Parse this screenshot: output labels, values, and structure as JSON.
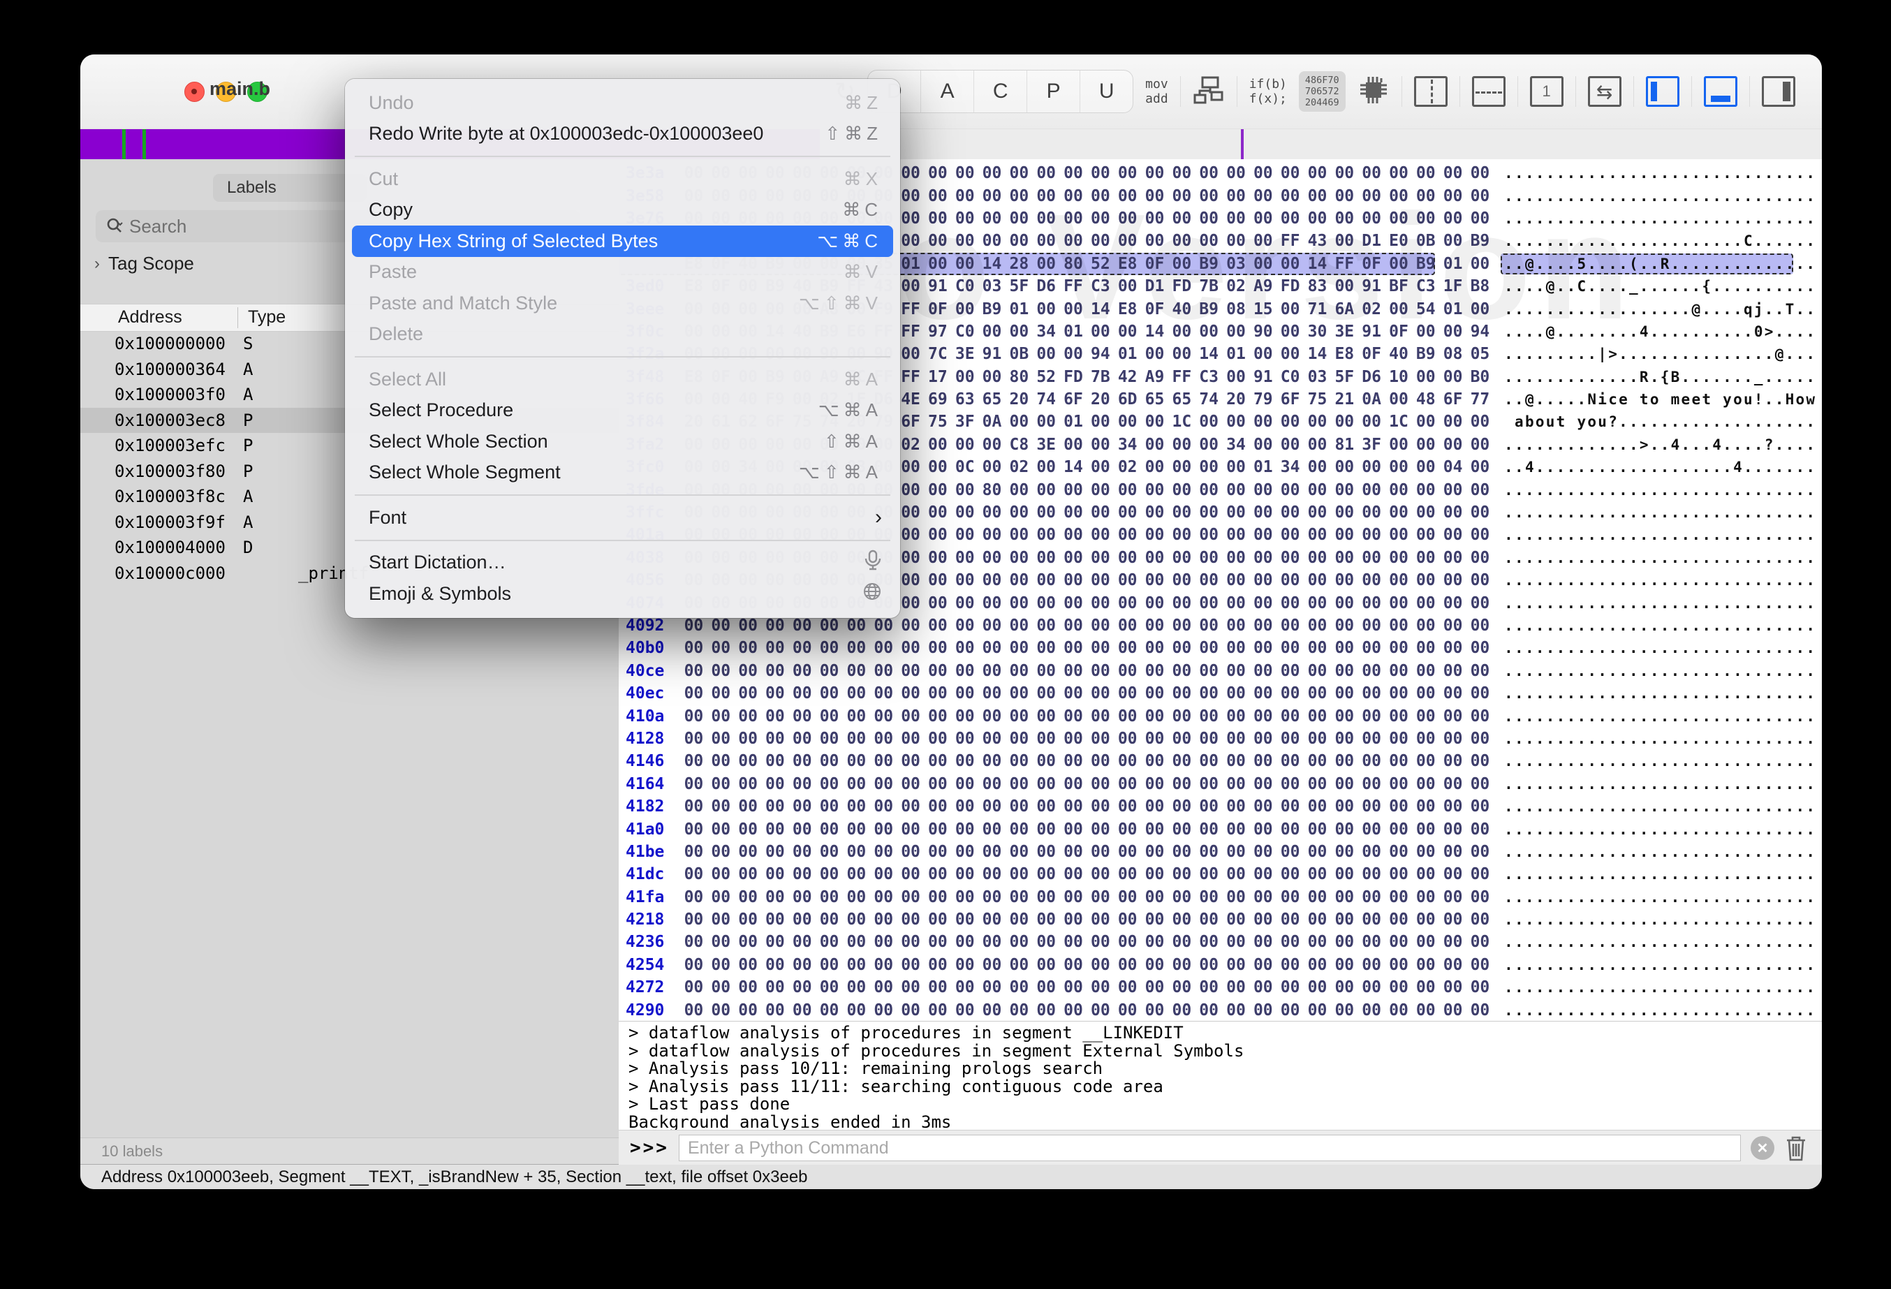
{
  "window": {
    "title": "main.b"
  },
  "menu": {
    "items": [
      {
        "label": "Undo",
        "shortcut": "⌘Z",
        "state": "disabled"
      },
      {
        "label": "Redo Write byte at 0x100003edc-0x100003ee0",
        "shortcut": "⇧⌘Z",
        "state": "enabled"
      },
      {
        "type": "sep"
      },
      {
        "label": "Cut",
        "shortcut": "⌘X",
        "state": "disabled"
      },
      {
        "label": "Copy",
        "shortcut": "⌘C",
        "state": "enabled"
      },
      {
        "label": "Copy Hex String of Selected Bytes",
        "shortcut": "⌥⌘C",
        "state": "highlighted"
      },
      {
        "label": "Paste",
        "shortcut": "⌘V",
        "state": "disabled"
      },
      {
        "label": "Paste and Match Style",
        "shortcut": "⌥⇧⌘V",
        "state": "disabled"
      },
      {
        "label": "Delete",
        "shortcut": "",
        "state": "disabled"
      },
      {
        "type": "sep"
      },
      {
        "label": "Select All",
        "shortcut": "⌘A",
        "state": "disabled"
      },
      {
        "label": "Select Procedure",
        "shortcut": "⌥⌘A",
        "state": "enabled"
      },
      {
        "label": "Select Whole Section",
        "shortcut": "⇧⌘A",
        "state": "enabled"
      },
      {
        "label": "Select Whole Segment",
        "shortcut": "⌥⇧⌘A",
        "state": "enabled"
      },
      {
        "type": "sep"
      },
      {
        "label": "Font",
        "state": "enabled",
        "submenu": true
      },
      {
        "type": "sep"
      },
      {
        "label": "Start Dictation…",
        "state": "enabled",
        "icon": "microphone"
      },
      {
        "label": "Emoji & Symbols",
        "state": "enabled",
        "icon": "globe"
      }
    ]
  },
  "toolbar": {
    "refresh": "↻",
    "modes": [
      "D",
      "A",
      "C",
      "P",
      "U"
    ],
    "mov_add": [
      "mov",
      "add"
    ],
    "if_fx": [
      "if(b)",
      "f(x);"
    ],
    "hex_chip": [
      "486F70",
      "706572",
      "204469"
    ],
    "swap_glyph": "⇆",
    "one_label": "1"
  },
  "sidebar": {
    "tab": "Labels",
    "search_placeholder": "Search",
    "tag_scope": "Tag Scope",
    "columns": {
      "address": "Address",
      "type": "Type"
    },
    "rows": [
      {
        "address": "0x100000000",
        "type": "S",
        "name": ""
      },
      {
        "address": "0x100000364",
        "type": "A",
        "name": ""
      },
      {
        "address": "0x1000003f0",
        "type": "A",
        "name": ""
      },
      {
        "address": "0x100003ec8",
        "type": "P",
        "name": "",
        "selected": true
      },
      {
        "address": "0x100003efc",
        "type": "P",
        "name": ""
      },
      {
        "address": "0x100003f80",
        "type": "P",
        "name": ""
      },
      {
        "address": "0x100003f8c",
        "type": "A",
        "name": ""
      },
      {
        "address": "0x100003f9f",
        "type": "A",
        "name": ""
      },
      {
        "address": "0x100004000",
        "type": "D",
        "name": ""
      },
      {
        "address": "0x10000c000",
        "type": "",
        "name": "_printf"
      }
    ],
    "footer": "10 labels"
  },
  "hex": {
    "watermark": "Demo Version",
    "colors": {
      "address": "#1414cc",
      "bytes": "#3d3d6b",
      "selection": "#b9baf4",
      "nav_purple": "#8a00d0"
    },
    "zero_bytes": "000000000000000000000000000000000000000000000000000000000000",
    "zero_ascii": "..............................",
    "rows": [
      {
        "a": "3e3a"
      },
      {
        "a": "3e58"
      },
      {
        "a": "3e76"
      },
      {
        "a": "3e94",
        "b": "00000000000000000000000000000000000000000000FF4300D1E00B00B9",
        "t": ".......................C......"
      },
      {
        "a": "3eb2",
        "b": "E80F40B9000000350100001428008052E80F00B903000014FF0F00B90100",
        "t": "..@....5....(..R..............",
        "sel": true
      },
      {
        "a": "3ed0",
        "b": "E80F00B940B9FF430091C0035FD6FFC300D1FD7B02A9FD830091BFC31FB8",
        "t": "....@..C...._......{.........."
      },
      {
        "a": "3eee",
        "b": "0000000000A800F9FF0F00B901000014E80F40B9081500716A0200540100",
        "t": "..................@....qj..T.."
      },
      {
        "a": "3f0c",
        "b": "0000001440B9E6FFFF97C0000034010000140000009000303E910F000094",
        "t": "....@........4..........0>...."
      },
      {
        "a": "3f2a",
        "b": "0000000000900090007C3E910B0000940100001401000014E80F40B90805",
        "t": ".........|>...............@..."
      },
      {
        "a": "3f48",
        "b": "E80F00B900A9ECFFFF1700008052FD7B42A9FFC30091C0035FD6100000B0",
        "t": ".............R.{B......._....."
      },
      {
        "a": "3f66",
        "b": "000040F900021FD64E69636520746F206D65657420796F75210A00486F77",
        "t": "..@.....Nice to meet you!..How"
      },
      {
        "a": "3f84",
        "b": "2061626F757420796F753F0A0000010000001C000000000000001C000000",
        "t": " about you?..................."
      },
      {
        "a": "3fa2",
        "b": "000000000000000002000000C83E00003400000034000000813F00000000",
        "t": ".............>..4...4....?...."
      },
      {
        "a": "3fc0",
        "b": "000034000000030000000C00020014000200000000013400000000000400",
        "t": "..4...................4......."
      },
      {
        "a": "3fde",
        "b": "000000000000000000000080000000000000000000000000000000000000"
      },
      {
        "a": "3ffc"
      },
      {
        "a": "401a"
      },
      {
        "a": "4038"
      },
      {
        "a": "4056"
      },
      {
        "a": "4074"
      },
      {
        "a": "4092"
      },
      {
        "a": "40b0"
      },
      {
        "a": "40ce"
      },
      {
        "a": "40ec"
      },
      {
        "a": "410a"
      },
      {
        "a": "4128"
      },
      {
        "a": "4146"
      },
      {
        "a": "4164"
      },
      {
        "a": "4182"
      },
      {
        "a": "41a0"
      },
      {
        "a": "41be"
      },
      {
        "a": "41dc"
      },
      {
        "a": "41fa"
      },
      {
        "a": "4218"
      },
      {
        "a": "4236"
      },
      {
        "a": "4254"
      },
      {
        "a": "4272"
      },
      {
        "a": "4290"
      }
    ]
  },
  "console": {
    "lines": [
      "> dataflow analysis of procedures in segment __LINKEDIT",
      "> dataflow analysis of procedures in segment External Symbols",
      "> Analysis pass 10/11: remaining prologs search",
      "> Analysis pass 11/11: searching contiguous code area",
      "> Last pass done",
      "Background analysis ended in 3ms"
    ],
    "prompt": ">>>",
    "placeholder": "Enter a Python Command",
    "clear_glyph": "✕"
  },
  "statusbar": {
    "text": "Address 0x100003eeb, Segment __TEXT, _isBrandNew + 35, Section __text, file offset 0x3eeb"
  }
}
